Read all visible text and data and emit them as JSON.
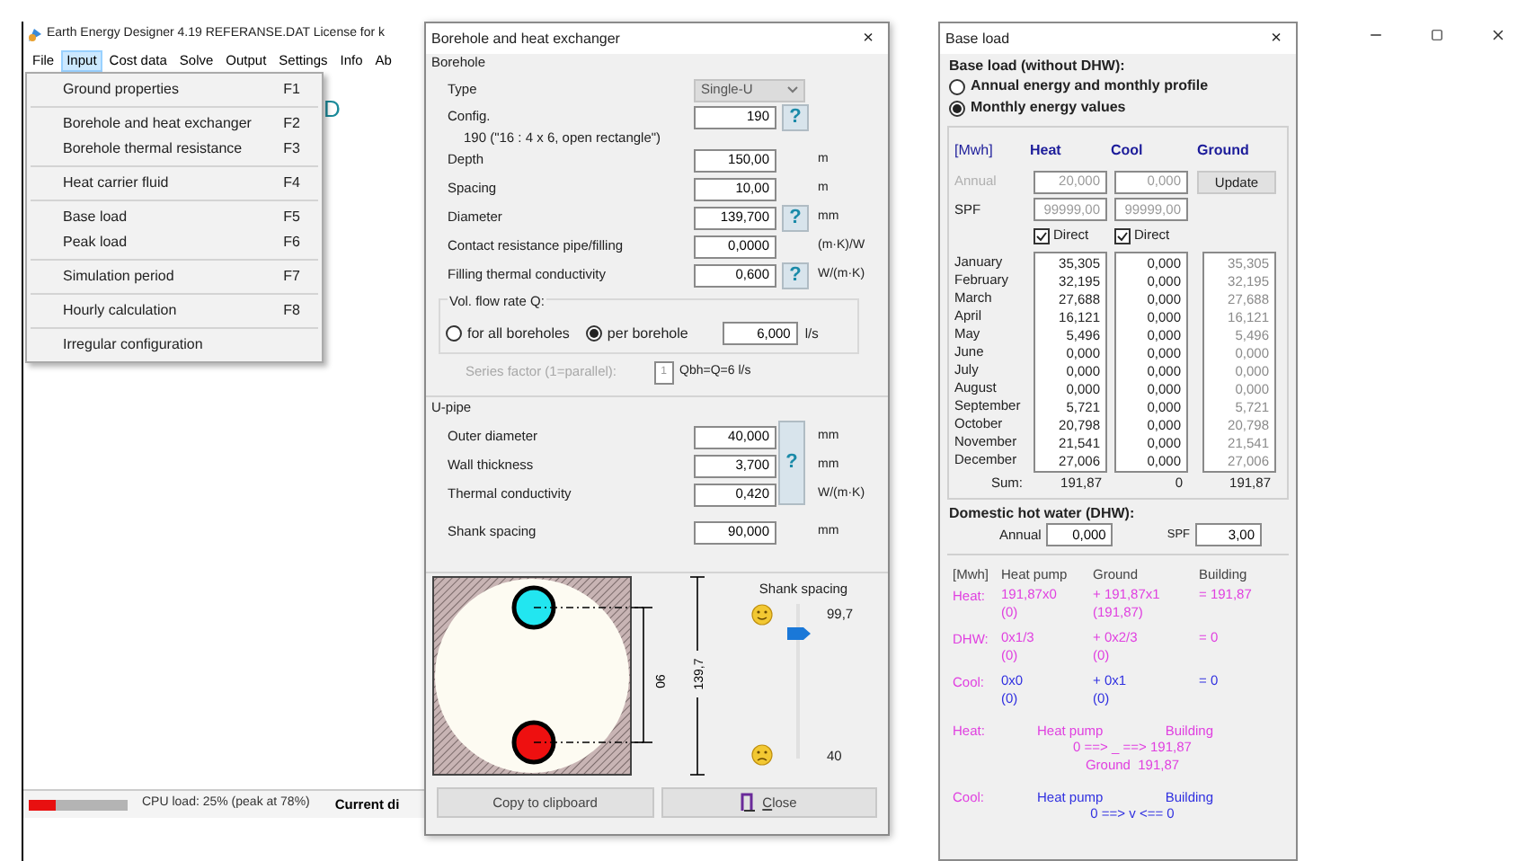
{
  "main_window": {
    "title": "Earth Energy Designer 4.19   REFERANSE.DAT   License for k",
    "menu": [
      {
        "label": "File",
        "selected": false
      },
      {
        "label": "Input",
        "selected": true
      },
      {
        "label": "Cost data",
        "selected": false
      },
      {
        "label": "Solve",
        "selected": false
      },
      {
        "label": "Output",
        "selected": false
      },
      {
        "label": "Settings",
        "selected": false
      },
      {
        "label": "Info",
        "selected": false
      },
      {
        "label": "Ab",
        "selected": false
      }
    ],
    "dropdown": [
      [
        {
          "label": "Ground properties",
          "shortcut": "F1"
        }
      ],
      [
        {
          "label": "Borehole and heat exchanger",
          "shortcut": "F2"
        },
        {
          "label": "Borehole thermal resistance",
          "shortcut": "F3"
        }
      ],
      [
        {
          "label": "Heat carrier fluid",
          "shortcut": "F4"
        }
      ],
      [
        {
          "label": "Base load",
          "shortcut": "F5"
        },
        {
          "label": "Peak load",
          "shortcut": "F6"
        }
      ],
      [
        {
          "label": "Simulation period",
          "shortcut": "F7"
        }
      ],
      [
        {
          "label": "Hourly calculation",
          "shortcut": "F8"
        }
      ],
      [
        {
          "label": "Irregular configuration"
        }
      ]
    ],
    "canvas_letter": "D",
    "status_bar": {
      "cpu": {
        "level": 0.27
      },
      "cpu_text": "CPU load: 25% (peak at 78%)",
      "current": "Current di"
    }
  },
  "borehole_dialog": {
    "title": "Borehole and heat exchanger",
    "close": "×",
    "borehole": {
      "title": "Borehole",
      "type": {
        "label": "Type",
        "value": "Single-U"
      },
      "fields": [
        {
          "label": "Config.",
          "value": "190",
          "help": "?",
          "note": "190 (\"16 : 4 x 6, open rectangle\")"
        },
        {
          "label": "Depth",
          "value": "150,00",
          "unit": "m"
        },
        {
          "label": "Spacing",
          "value": "10,00",
          "unit": "m"
        },
        {
          "label": "Diameter",
          "value": "139,700",
          "help": "?",
          "unit": "mm"
        },
        {
          "label": "Contact resistance pipe/filling",
          "value": "0,0000",
          "unit": "(m·K)/W"
        },
        {
          "label": "Filling thermal conductivity",
          "value": "0,600",
          "help": "?",
          "unit": "W/(m·K)"
        }
      ],
      "flow": {
        "title": "Vol. flow rate Q:",
        "options": [
          {
            "label": "for all boreholes",
            "selected": false
          },
          {
            "label": "per borehole",
            "selected": true
          }
        ],
        "value": "6,000",
        "unit": "l/s"
      },
      "series": {
        "label": "Series factor (1=parallel):",
        "value": "1",
        "note": "Qbh=Q=6 l/s",
        "disabled": true
      }
    },
    "upipe": {
      "title": "U-pipe",
      "help": "?",
      "fields": [
        {
          "label": "Outer diameter",
          "value": "40,000",
          "unit": "mm"
        },
        {
          "label": "Wall thickness",
          "value": "3,700",
          "unit": "mm"
        },
        {
          "label": "Thermal conductivity",
          "value": "0,420",
          "unit": "W/(m·K)"
        },
        {
          "label": "Shank spacing",
          "value": "90,000",
          "unit": "mm"
        }
      ]
    },
    "diagram": {
      "shank_label": "90",
      "diameter_label": "139,7"
    },
    "slider": {
      "title": "Shank spacing",
      "max": "99,7",
      "min": "40",
      "level": 0.84
    },
    "buttons": [
      {
        "label": "Copy to clipboard",
        "kind": "plain"
      },
      {
        "label": "Close",
        "kind": "close"
      }
    ]
  },
  "base_load_dialog": {
    "title": "Base load",
    "close": "×",
    "heading": "Base load (without DHW):",
    "modes": [
      {
        "label": "Annual energy and monthly profile",
        "selected": false
      },
      {
        "label": "Monthly energy values",
        "selected": true
      }
    ],
    "table": {
      "unit": "[Mwh]",
      "columns": [
        "Heat",
        "Cool",
        "Ground"
      ],
      "annual": {
        "label": "Annual",
        "values": [
          "20,000",
          "0,000"
        ],
        "disabled": true
      },
      "update": "Update",
      "spf": {
        "label": "SPF",
        "values": [
          "99999,00",
          "99999,00"
        ]
      },
      "direct": [
        {
          "label": "Direct",
          "checked": true
        },
        {
          "label": "Direct",
          "checked": true
        }
      ],
      "months": [
        {
          "name": "January",
          "heat": "35,305",
          "cool": "0,000",
          "ground": "35,305"
        },
        {
          "name": "February",
          "heat": "32,195",
          "cool": "0,000",
          "ground": "32,195"
        },
        {
          "name": "March",
          "heat": "27,688",
          "cool": "0,000",
          "ground": "27,688"
        },
        {
          "name": "April",
          "heat": "16,121",
          "cool": "0,000",
          "ground": "16,121"
        },
        {
          "name": "May",
          "heat": "5,496",
          "cool": "0,000",
          "ground": "5,496"
        },
        {
          "name": "June",
          "heat": "0,000",
          "cool": "0,000",
          "ground": "0,000"
        },
        {
          "name": "July",
          "heat": "0,000",
          "cool": "0,000",
          "ground": "0,000"
        },
        {
          "name": "August",
          "heat": "0,000",
          "cool": "0,000",
          "ground": "0,000"
        },
        {
          "name": "September",
          "heat": "5,721",
          "cool": "0,000",
          "ground": "5,721"
        },
        {
          "name": "October",
          "heat": "20,798",
          "cool": "0,000",
          "ground": "20,798"
        },
        {
          "name": "November",
          "heat": "21,541",
          "cool": "0,000",
          "ground": "21,541"
        },
        {
          "name": "December",
          "heat": "27,006",
          "cool": "0,000",
          "ground": "27,006"
        }
      ],
      "sum": {
        "label": "Sum:",
        "heat": "191,87",
        "cool": "0",
        "ground": "191,87"
      }
    },
    "dhw": {
      "heading": "Domestic hot water (DHW):",
      "annual_label": "Annual",
      "annual": "0,000",
      "spf_label": "SPF",
      "spf": "3,00"
    },
    "balance": {
      "columns": [
        "[Mwh]",
        "Heat pump",
        "Ground",
        "Building"
      ],
      "rows": [
        {
          "label": "Heat:",
          "color": "#e040e0",
          "pump": [
            "191,87x0",
            "(0)"
          ],
          "ground": [
            "+ 191,87x1",
            "(191,87)"
          ],
          "building": "= 191,87"
        },
        {
          "label": "DHW:",
          "color": "#e040e0",
          "pump": [
            "0x1/3",
            "(0)"
          ],
          "ground": [
            "+ 0x2/3",
            "(0)"
          ],
          "building": "= 0"
        },
        {
          "label": "Cool:",
          "color": "#3030e0",
          "pump": [
            "0x0",
            "(0)"
          ],
          "ground": [
            "+ 0x1",
            "(0)"
          ],
          "building": "= 0"
        }
      ]
    },
    "flows": [
      {
        "label": "Heat:",
        "color": "#e040e0",
        "pump": "Heat pump",
        "building": "Building",
        "line": "0 ==> _ ==> 191,87",
        "ground": "Ground  191,87"
      },
      {
        "label": "Cool:",
        "color": "#3030e0",
        "pump": "Heat pump",
        "building": "Building",
        "line": "0 ==> v <== 0"
      }
    ]
  }
}
